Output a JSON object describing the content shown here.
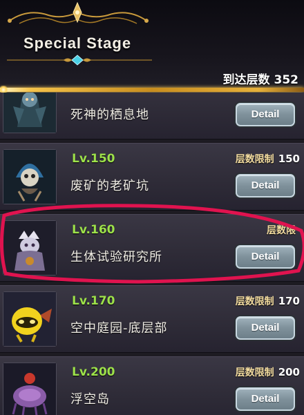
{
  "header": {
    "title": "Special Stage",
    "reach_label": "到达层数",
    "reach_value": "352"
  },
  "stages": [
    {
      "level": "",
      "name": "死神的栖息地",
      "limit_label": "",
      "limit_value": "",
      "detail_label": "Detail"
    },
    {
      "level": "Lv.150",
      "name": "废矿的老矿坑",
      "limit_label": "层数限制",
      "limit_value": "150",
      "detail_label": "Detail"
    },
    {
      "level": "Lv.160",
      "name": "生体试验研究所",
      "limit_label": "层数限",
      "limit_value": "",
      "detail_label": "Detail"
    },
    {
      "level": "Lv.170",
      "name": "空中庭园-底层部",
      "limit_label": "层数限制",
      "limit_value": "170",
      "detail_label": "Detail"
    },
    {
      "level": "Lv.200",
      "name": "浮空岛",
      "limit_label": "层数限制",
      "limit_value": "200",
      "detail_label": "Detail"
    }
  ],
  "colors": {
    "level_text": "#9de14a",
    "limit_label": "#f3dca0",
    "annotation": "#e0134f",
    "gold": "#e6b03b"
  },
  "icons": {
    "portrait_0": "reaper-monster-icon",
    "portrait_1": "skull-mage-icon",
    "portrait_2": "ghost-scientist-icon",
    "portrait_3": "yellow-blob-icon",
    "portrait_4": "jellyfish-monster-icon"
  }
}
